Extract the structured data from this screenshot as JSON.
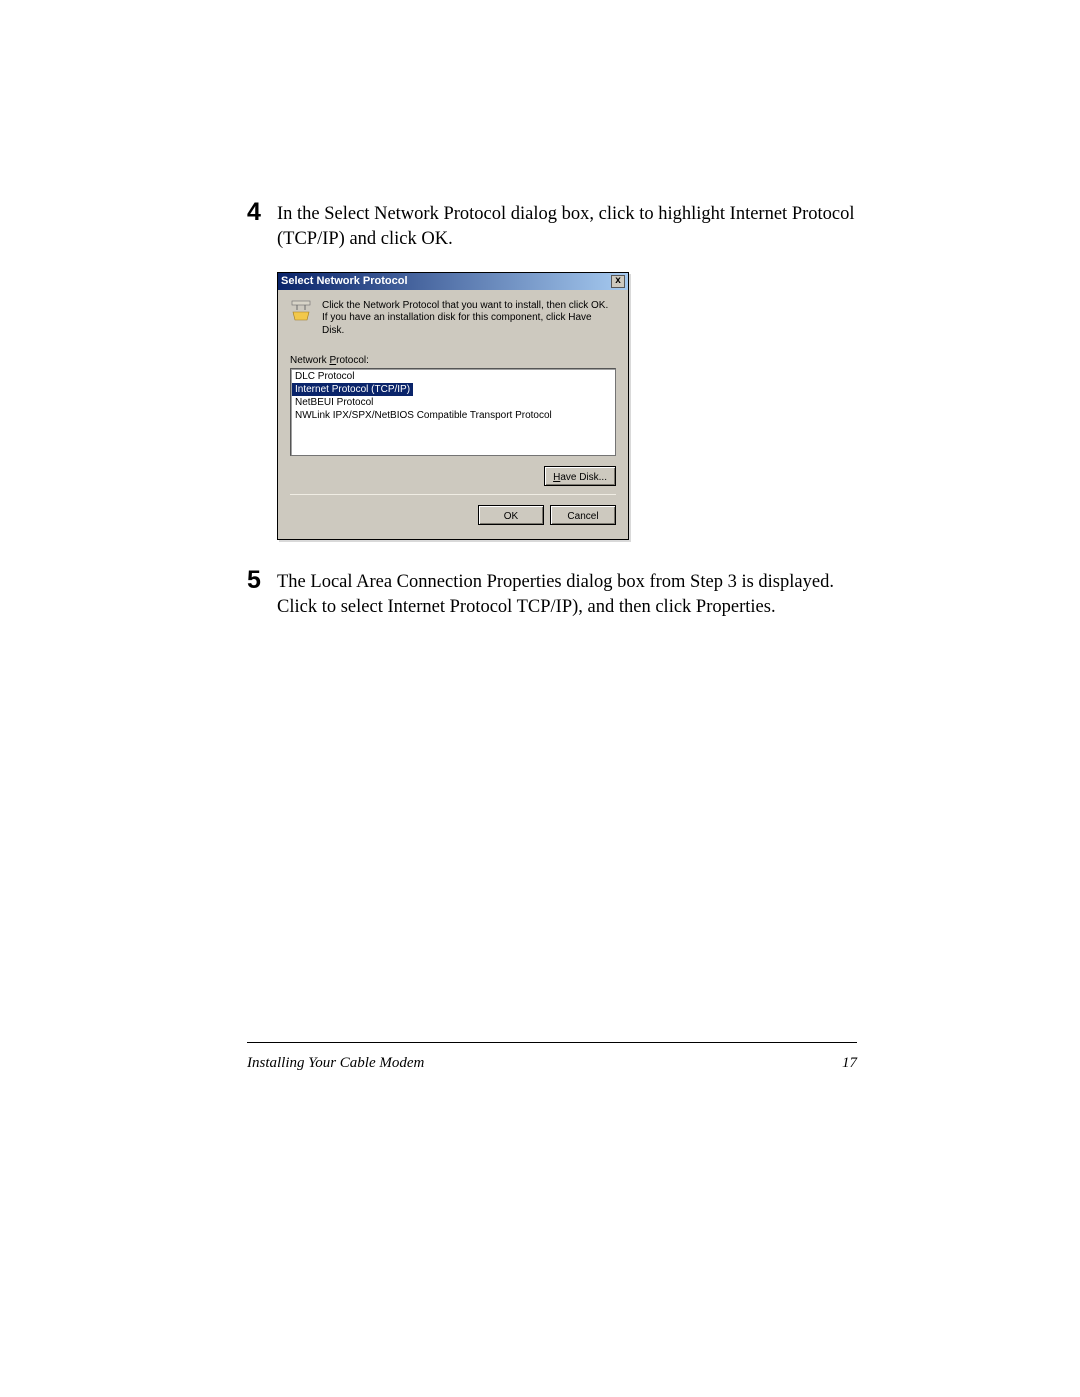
{
  "step4": {
    "num": "4",
    "text_a": "In the ",
    "text_b": "Select Network Protocol",
    "text_c": " dialog box, click to highlight ",
    "text_d": "Internet Protocol (TCP/IP)",
    "text_e": " and click OK."
  },
  "dialog": {
    "title": "Select Network Protocol",
    "close": "x",
    "info": "Click the Network Protocol that you want to install, then click OK. If you have an installation disk for this component, click Have Disk.",
    "label_prefix": "Network ",
    "label_u": "P",
    "label_suffix": "rotocol:",
    "items": {
      "0": "DLC Protocol",
      "1": "Internet Protocol (TCP/IP)",
      "2": "NetBEUI Protocol",
      "3": "NWLink IPX/SPX/NetBIOS Compatible Transport Protocol"
    },
    "have_u": "H",
    "have_rest": "ave Disk...",
    "ok": "OK",
    "cancel": "Cancel"
  },
  "step5": {
    "num": "5",
    "text_a": "The ",
    "text_b": "Local Area Connection Properties",
    "text_c": " dialog box from Step 3 is displayed. Click to select ",
    "text_d": "Internet Protocol TCP/IP)",
    "text_e": ", and then click ",
    "text_f": "Properties",
    "text_g": "."
  },
  "footer": {
    "title": "Installing Your Cable Modem",
    "page": "17"
  }
}
